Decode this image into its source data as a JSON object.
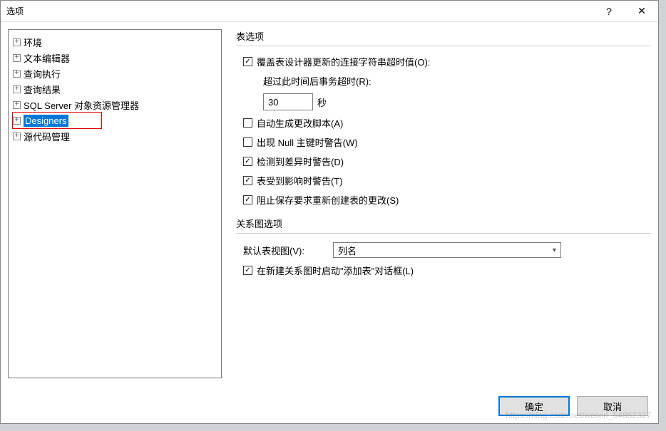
{
  "window": {
    "title": "选项"
  },
  "tree": {
    "items": [
      {
        "label": "环境"
      },
      {
        "label": "文本编辑器"
      },
      {
        "label": "查询执行"
      },
      {
        "label": "查询结果"
      },
      {
        "label": "SQL Server 对象资源管理器"
      },
      {
        "label": "Designers",
        "selected": true
      },
      {
        "label": "源代码管理"
      }
    ]
  },
  "tableGroup": {
    "title": "表选项",
    "overrideConn": {
      "label": "覆盖表设计器更新的连接字符串超时值(O):",
      "checked": true
    },
    "timeoutLabel": "超过此时间后事务超时(R):",
    "timeoutValue": "30",
    "timeoutUnit": "秒",
    "autoScript": {
      "label": "自动生成更改脚本(A)",
      "checked": false
    },
    "nullWarn": {
      "label": "出现 Null 主键时警告(W)",
      "checked": false
    },
    "diffWarn": {
      "label": "检测到差异时警告(D)",
      "checked": true
    },
    "affectWarn": {
      "label": "表受到影响时警告(T)",
      "checked": true
    },
    "preventSave": {
      "label": "阻止保存要求重新创建表的更改(S)",
      "checked": true
    }
  },
  "diagramGroup": {
    "title": "关系图选项",
    "defaultViewLabel": "默认表视图(V):",
    "defaultViewValue": "列名",
    "launchAdd": {
      "label": "在新建关系图时启动\"添加表\"对话框(L)",
      "checked": true
    }
  },
  "buttons": {
    "ok": "确定",
    "cancel": "取消"
  },
  "watermark": "https://blog.csdn.net/weixin_54862327"
}
